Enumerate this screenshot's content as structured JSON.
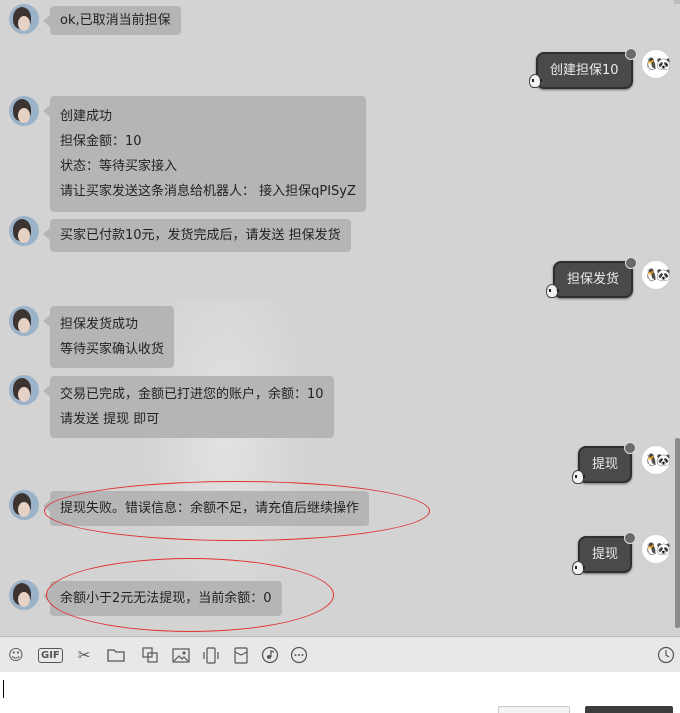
{
  "messages": {
    "m1": {
      "line1": "ok,已取消当前担保"
    },
    "m2": {
      "text": "创建担保10"
    },
    "m3": {
      "line1": "创建成功",
      "line2": "担保金额：10",
      "line3": "状态：等待买家接入",
      "line4": "请让买家发送这条消息给机器人： 接入担保qPISyZ"
    },
    "m4": {
      "line1": "买家已付款10元，发货完成后，请发送 担保发货"
    },
    "m5": {
      "text": "担保发货"
    },
    "m6": {
      "line1": "担保发货成功",
      "line2": "等待买家确认收货"
    },
    "m7": {
      "line1": "交易已完成，金额已打进您的账户，余额：10",
      "line2": "请发送 提现 即可"
    },
    "m8": {
      "text": "提现"
    },
    "m9": {
      "line1": "提现失败。错误信息：余额不足，请充值后继续操作"
    },
    "m10": {
      "text": "提现"
    },
    "m11": {
      "line1": "余额小于2元无法提现，当前余额：0"
    }
  },
  "avatars": {
    "me_glyph": "🐧🐼"
  },
  "toolbar": {
    "gif_label": "GIF",
    "icons": [
      "smile-icon",
      "gif-icon",
      "scissors-icon",
      "folder-icon",
      "translate-icon",
      "image-icon",
      "vibrate-icon",
      "red-packet-icon",
      "music-icon",
      "more-icon",
      "history-icon"
    ]
  },
  "colors": {
    "highlight_ellipse": "#e03030",
    "bot_bubble": "#b5b5b5",
    "my_bubble": "#4a4a4a"
  }
}
